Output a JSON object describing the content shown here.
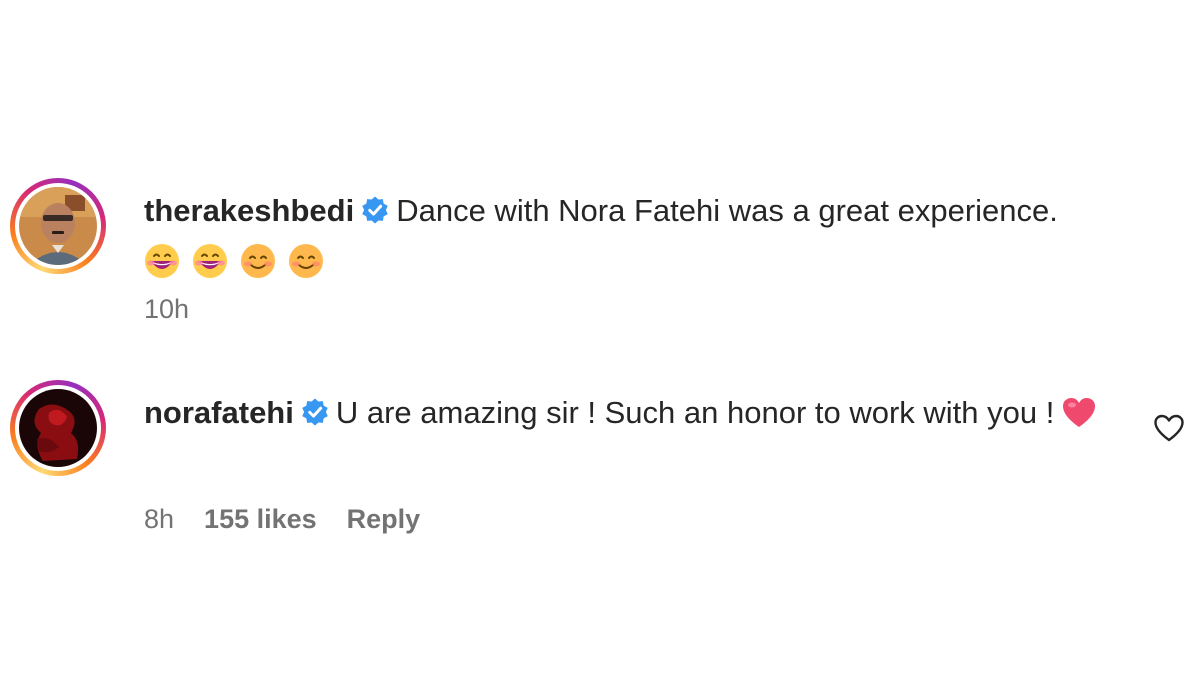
{
  "comments": [
    {
      "username": "therakeshbedi",
      "verified": true,
      "text": "Dance with Nora Fatehi was a great experience.",
      "emojis": [
        "grinning-face-icon",
        "grinning-face-icon",
        "smiling-face-icon",
        "smiling-face-icon"
      ],
      "time": "10h"
    },
    {
      "username": "norafatehi",
      "verified": true,
      "text": "U are amazing sir ! Such an honor to work with you !",
      "emojis": [
        "heart-icon"
      ],
      "time": "8h",
      "likes": "155 likes",
      "reply_label": "Reply"
    }
  ],
  "colors": {
    "verified": "#3897f0",
    "heart": "#f0496e",
    "meta_text": "#737373",
    "text": "#262626"
  }
}
